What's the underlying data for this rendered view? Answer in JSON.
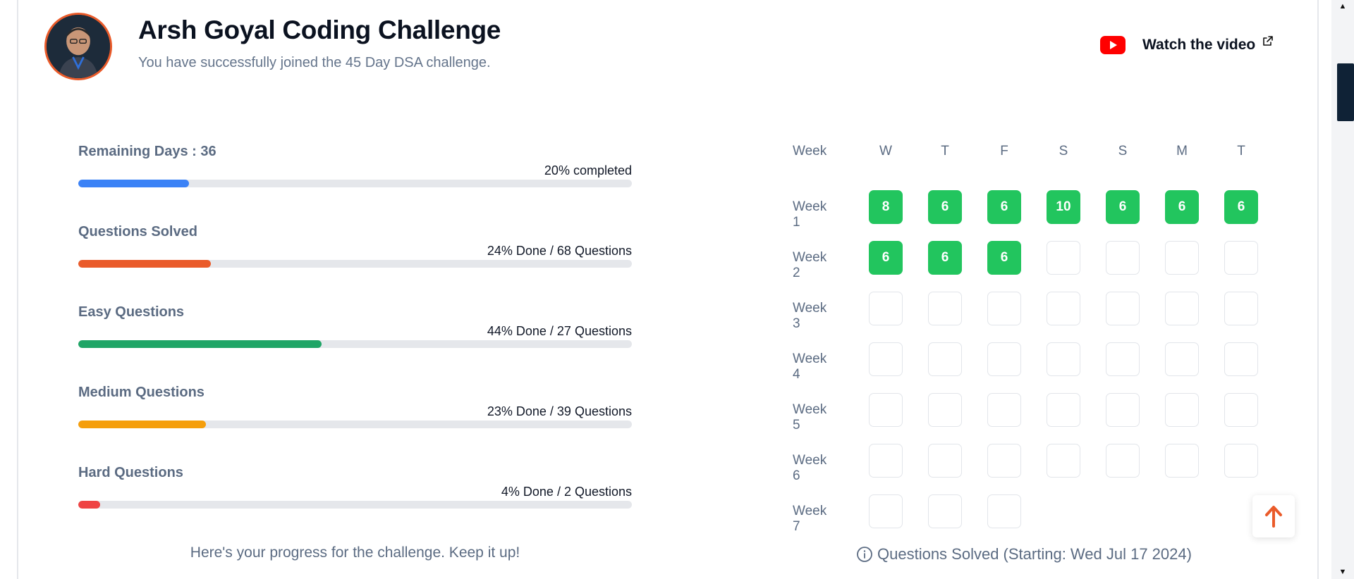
{
  "header": {
    "title": "Arsh Goyal Coding Challenge",
    "subtitle": "You have successfully joined the 45 Day DSA challenge.",
    "video_link_label": "Watch the video",
    "avatar_icon": "avatar-photo",
    "video_icon": "youtube-icon",
    "external_icon": "external-link-icon"
  },
  "progress": {
    "items": [
      {
        "label": "Remaining Days : 36",
        "stat": "20% completed",
        "percent": 20,
        "color": "#3b82f6"
      },
      {
        "label": "Questions Solved",
        "stat": "24% Done / 68 Questions",
        "percent": 24,
        "color": "#ea5b2a"
      },
      {
        "label": "Easy Questions",
        "stat": "44% Done / 27 Questions",
        "percent": 44,
        "color": "#1fa566"
      },
      {
        "label": "Medium Questions",
        "stat": "23% Done / 39 Questions",
        "percent": 23,
        "color": "#f59e0b"
      },
      {
        "label": "Hard Questions",
        "stat": "4% Done / 2 Questions",
        "percent": 4,
        "color": "#ef4444"
      }
    ],
    "caption": "Here's your progress for the challenge. Keep it up!"
  },
  "calendar": {
    "week_header": "Week",
    "days": [
      "W",
      "T",
      "F",
      "S",
      "S",
      "M",
      "T"
    ],
    "weeks": [
      {
        "label": "Week 1",
        "cells": [
          "8",
          "6",
          "6",
          "10",
          "6",
          "6",
          "6"
        ]
      },
      {
        "label": "Week 2",
        "cells": [
          "6",
          "6",
          "6",
          "",
          "",
          "",
          ""
        ]
      },
      {
        "label": "Week 3",
        "cells": [
          "",
          "",
          "",
          "",
          "",
          "",
          ""
        ]
      },
      {
        "label": "Week 4",
        "cells": [
          "",
          "",
          "",
          "",
          "",
          "",
          ""
        ]
      },
      {
        "label": "Week 5",
        "cells": [
          "",
          "",
          "",
          "",
          "",
          "",
          ""
        ]
      },
      {
        "label": "Week 6",
        "cells": [
          "",
          "",
          "",
          "",
          "",
          "",
          ""
        ]
      },
      {
        "label": "Week 7",
        "cells": [
          "",
          "",
          ""
        ]
      }
    ],
    "filled_color": "#22c55e",
    "caption": "Questions Solved (Starting: Wed Jul 17 2024)",
    "info_icon": "info-icon"
  },
  "scroll_top_icon": "arrow-up-icon",
  "accent_color": "#ea5b2a"
}
